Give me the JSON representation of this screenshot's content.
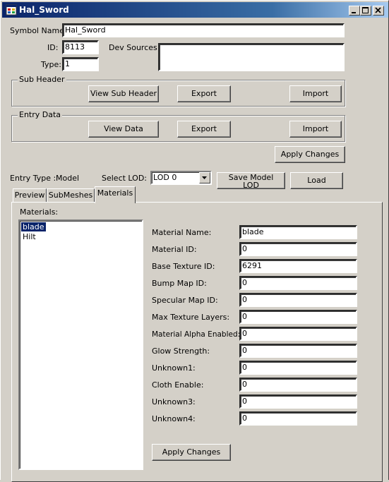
{
  "window": {
    "title": "Hal_Sword"
  },
  "symbol": {
    "name_label": "Symbol Name:",
    "name_value": "Hal_Sword",
    "id_label": "ID:",
    "id_value": "8113",
    "type_label": "Type:",
    "type_value": "1",
    "dev_sources_label": "Dev Sources:",
    "dev_sources_value": ""
  },
  "sub_header": {
    "title": "Sub Header",
    "view_label": "View Sub Header",
    "export_label": "Export",
    "import_label": "Import"
  },
  "entry_data": {
    "title": "Entry Data",
    "view_label": "View Data",
    "export_label": "Export",
    "import_label": "Import"
  },
  "apply_changes_top": "Apply Changes",
  "entry_type": {
    "label": "Entry Type :",
    "value": "Model"
  },
  "lod": {
    "label": "Select LOD:",
    "selected": "LOD 0",
    "save_label_line1": "Save Model",
    "save_label_line2": "LOD",
    "load_label": "Load"
  },
  "tabs": [
    {
      "label": "Preview"
    },
    {
      "label": "SubMeshes"
    },
    {
      "label": "Materials"
    }
  ],
  "materials": {
    "list_label": "Materials:",
    "items": [
      "blade",
      "Hilt"
    ],
    "selected_index": 0,
    "fields": [
      {
        "label": "Material Name:",
        "value": "blade"
      },
      {
        "label": "Material ID:",
        "value": "0"
      },
      {
        "label": "Base Texture ID:",
        "value": "6291"
      },
      {
        "label": "Bump Map ID:",
        "value": "0"
      },
      {
        "label": "Specular Map ID:",
        "value": "0"
      },
      {
        "label": "Max Texture Layers:",
        "value": "0"
      },
      {
        "label": "Material Alpha Enabled:",
        "value": "0"
      },
      {
        "label": "Glow Strength:",
        "value": "0"
      },
      {
        "label": "Unknown1:",
        "value": "0"
      },
      {
        "label": "Cloth Enable:",
        "value": "0"
      },
      {
        "label": "Unknown3:",
        "value": "0"
      },
      {
        "label": "Unknown4:",
        "value": "0"
      }
    ],
    "apply_label": "Apply Changes"
  },
  "icons": {
    "app": "app-window-icon",
    "minimize": "minimize-icon",
    "maximize": "maximize-icon",
    "close": "close-icon",
    "dropdown": "chevron-down-icon"
  },
  "colors": {
    "title_start": "#0a246a",
    "title_end": "#a6caf0",
    "face": "#d4d0c8",
    "selection": "#0a246a"
  }
}
